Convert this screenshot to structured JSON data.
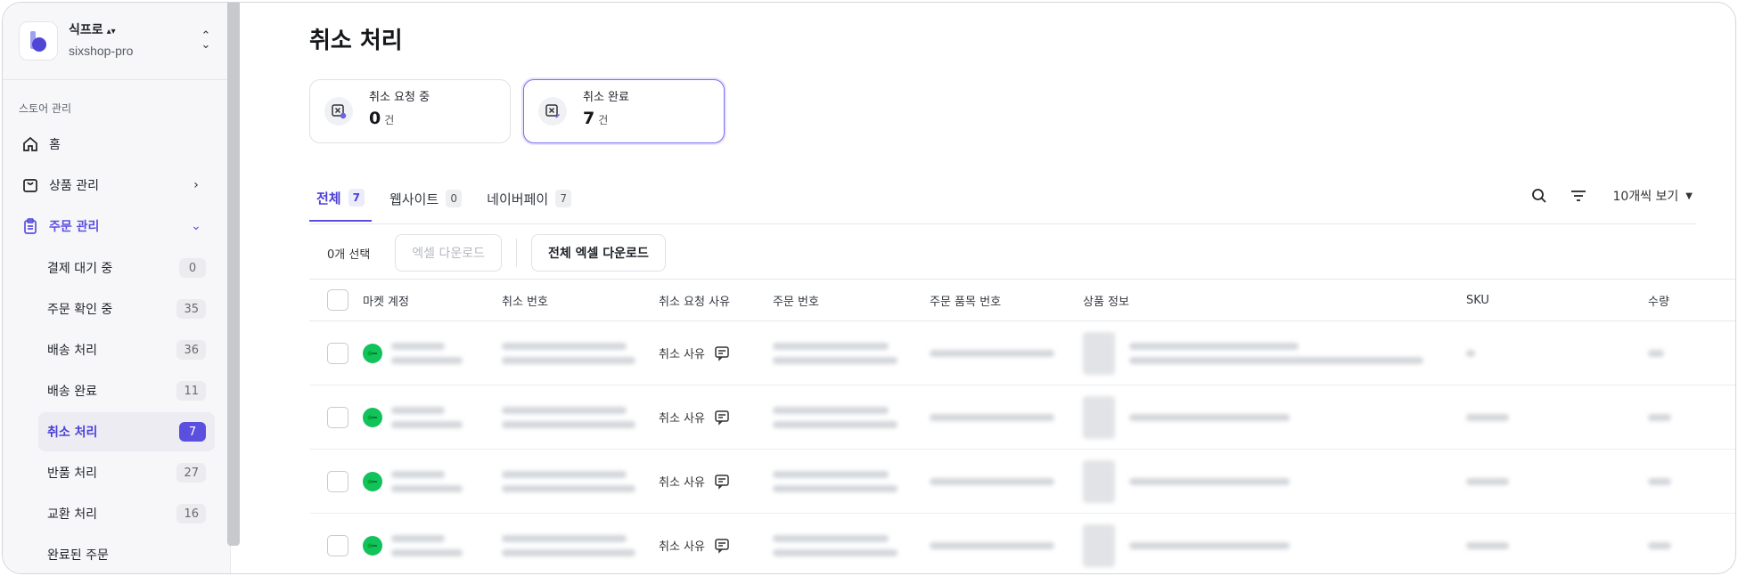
{
  "store": {
    "name": "식프로",
    "id": "sixshop-pro",
    "switch_glyph": "⬍"
  },
  "sidebar": {
    "section_title": "스토어 관리",
    "nav": [
      {
        "label": "홈",
        "icon": "home-icon"
      },
      {
        "label": "상품 관리",
        "icon": "bag-icon"
      },
      {
        "label": "주문 관리",
        "icon": "clipboard-icon"
      }
    ],
    "sub_items": [
      {
        "label": "결제 대기 중",
        "count": "0"
      },
      {
        "label": "주문 확인 중",
        "count": "35"
      },
      {
        "label": "배송 처리",
        "count": "36"
      },
      {
        "label": "배송 완료",
        "count": "11"
      },
      {
        "label": "취소 처리",
        "count": "7"
      },
      {
        "label": "반품 처리",
        "count": "27"
      },
      {
        "label": "교환 처리",
        "count": "16"
      },
      {
        "label": "완료된 주문",
        "count": ""
      }
    ]
  },
  "page": {
    "title": "취소 처리"
  },
  "stats": [
    {
      "label": "취소 요청 중",
      "value": "0",
      "unit": "건"
    },
    {
      "label": "취소 완료",
      "value": "7",
      "unit": "건"
    }
  ],
  "tabs": [
    {
      "label": "전체",
      "count": "7"
    },
    {
      "label": "웹사이트",
      "count": "0"
    },
    {
      "label": "네이버페이",
      "count": "7"
    }
  ],
  "tools": {
    "page_size": "10개씩 보기"
  },
  "actions": {
    "selected_count": "0개 선택",
    "excel_download": "엑셀 다운로드",
    "excel_download_all": "전체 엑셀 다운로드"
  },
  "table": {
    "headers": [
      "마켓 계정",
      "취소 번호",
      "취소 요청 사유",
      "주문 번호",
      "주문 품목 번호",
      "상품 정보",
      "SKU",
      "수량"
    ],
    "rows": [
      {
        "reason": "취소 사유"
      },
      {
        "reason": "취소 사유"
      },
      {
        "reason": "취소 사유"
      },
      {
        "reason": "취소 사유"
      }
    ]
  },
  "colors": {
    "accent": "#5b4fe0",
    "market_green": "#12c25a"
  }
}
